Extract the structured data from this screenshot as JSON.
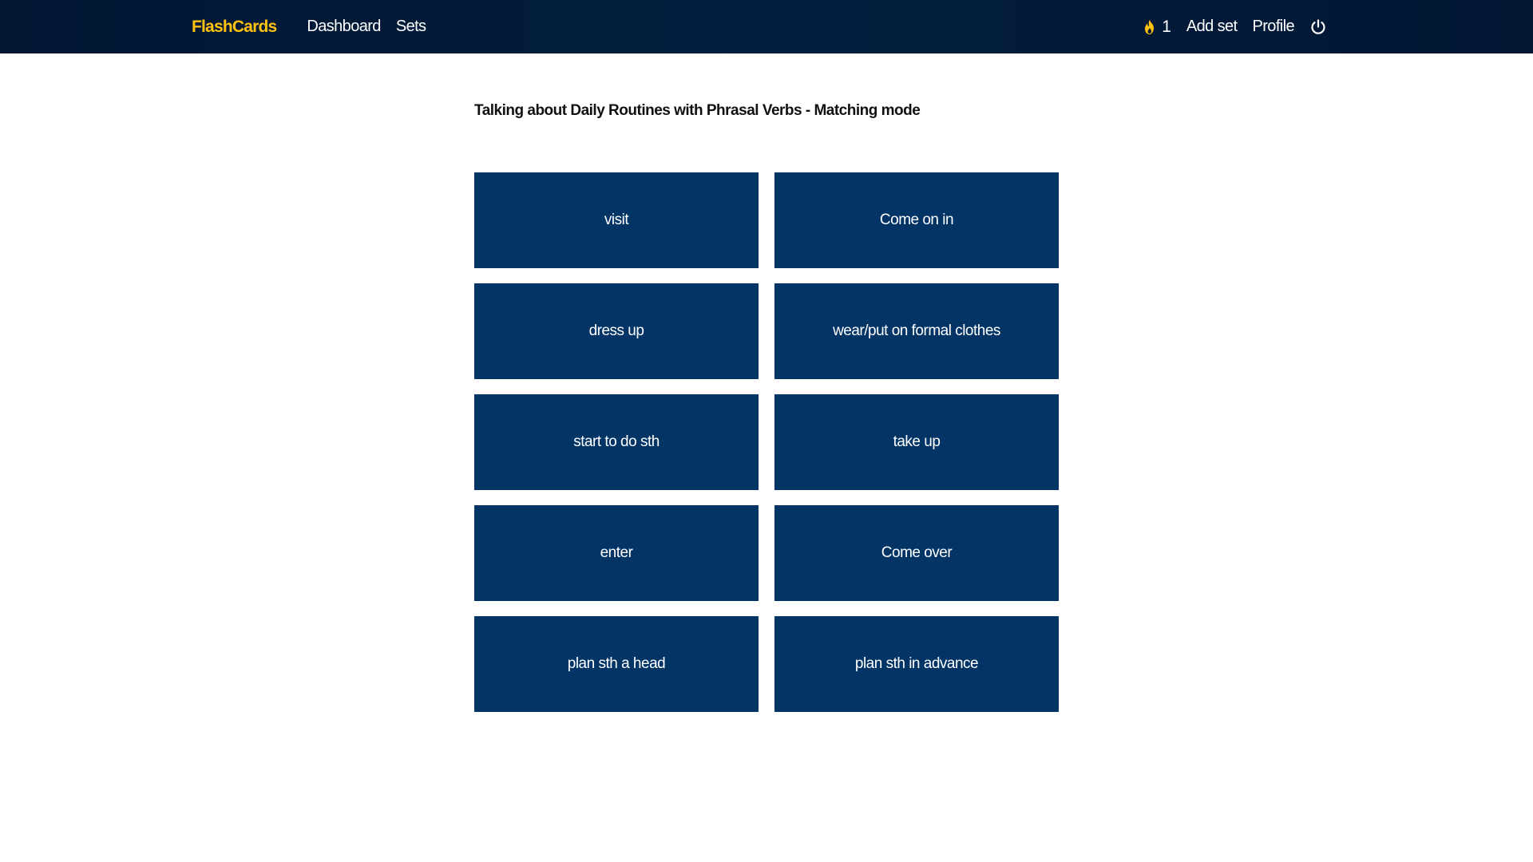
{
  "nav": {
    "brand": "FlashCards",
    "links": [
      "Dashboard",
      "Sets"
    ],
    "streak_count": "1",
    "add_set": "Add set",
    "profile": "Profile"
  },
  "page": {
    "title": "Talking about Daily Routines with Phrasal Verbs - Matching mode"
  },
  "cards": [
    "visit",
    "Come on in",
    "dress up",
    "wear/put on formal clothes",
    "start to do sth",
    "take up",
    "enter",
    "Come over",
    "plan sth a head",
    "plan sth in advance"
  ],
  "colors": {
    "navbar": "#021833",
    "brand": "#ffc20e",
    "card": "#023466",
    "streak_icon": "#ffc20e"
  },
  "icons": {
    "streak": "flame-icon",
    "logout": "power-icon"
  }
}
